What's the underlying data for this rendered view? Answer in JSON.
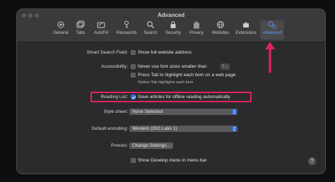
{
  "window": {
    "title": "Advanced",
    "tabs": [
      {
        "label": "General",
        "icon": "gear-icon"
      },
      {
        "label": "Tabs",
        "icon": "tabs-icon"
      },
      {
        "label": "AutoFill",
        "icon": "autofill-icon"
      },
      {
        "label": "Passwords",
        "icon": "key-icon"
      },
      {
        "label": "Search",
        "icon": "search-icon"
      },
      {
        "label": "Security",
        "icon": "lock-icon"
      },
      {
        "label": "Privacy",
        "icon": "hand-icon"
      },
      {
        "label": "Websites",
        "icon": "globe-icon"
      },
      {
        "label": "Extensions",
        "icon": "puzzle-icon"
      },
      {
        "label": "Advanced",
        "icon": "advanced-gears-icon"
      }
    ],
    "active_tab": "Advanced"
  },
  "settings": {
    "smart_search_label": "Smart Search Field:",
    "show_full_address": "Show full website address",
    "accessibility_label": "Accessibility:",
    "never_font_sizes": "Never use font sizes smaller than",
    "font_size_value": "9",
    "press_tab": "Press Tab to highlight each item on a web page",
    "option_tab_note": "Option-Tab highlights each item.",
    "reading_list_label": "Reading List:",
    "save_articles": "Save articles for offline reading automatically",
    "style_sheet_label": "Style sheet:",
    "style_sheet_value": "None Selected",
    "default_encoding_label": "Default encoding:",
    "default_encoding_value": "Western (ISO Latin 1)",
    "proxies_label": "Proxies:",
    "change_settings": "Change Settings...",
    "show_develop": "Show Develop menu in menu bar",
    "help": "?"
  },
  "colors": {
    "accent": "#2f6fe0",
    "annotation": "#e0245e",
    "active_tab_text": "#5ea0ff"
  }
}
